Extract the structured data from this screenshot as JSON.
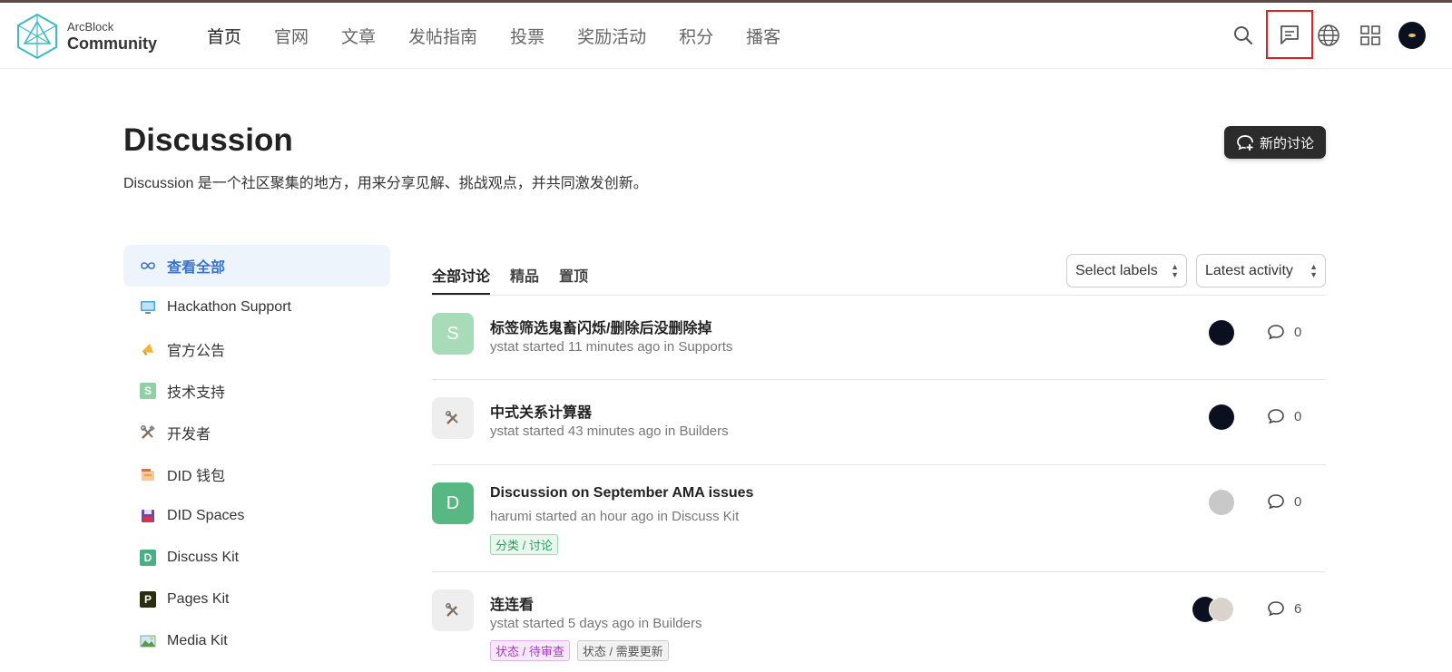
{
  "header": {
    "logo_line1": "ArcBlock",
    "logo_line2": "Community",
    "nav": [
      {
        "label": "首页",
        "active": true
      },
      {
        "label": "官网"
      },
      {
        "label": "文章"
      },
      {
        "label": "发帖指南"
      },
      {
        "label": "投票"
      },
      {
        "label": "奖励活动"
      },
      {
        "label": "积分"
      },
      {
        "label": "播客"
      }
    ],
    "icons": [
      "search-icon",
      "chat-icon",
      "globe-icon",
      "apps-grid-icon",
      "user-avatar"
    ]
  },
  "page": {
    "title": "Discussion",
    "subtitle": "Discussion 是一个社区聚集的地方，用来分享见解、挑战观点，并共同激发创新。",
    "new_button": "新的讨论"
  },
  "sidebar": {
    "items": [
      {
        "label": "查看全部",
        "icon": "infinity-icon",
        "active": true
      },
      {
        "label": "Hackathon Support",
        "icon": "monitor-icon"
      },
      {
        "label": "官方公告",
        "icon": "megaphone-icon"
      },
      {
        "label": "技术支持",
        "icon": "letter-s-icon",
        "icon_text": "S",
        "color": "#8fd1a4"
      },
      {
        "label": "开发者",
        "icon": "tools-icon"
      },
      {
        "label": "DID 钱包",
        "icon": "wallet-icon"
      },
      {
        "label": "DID Spaces",
        "icon": "floppy-icon"
      },
      {
        "label": "Discuss Kit",
        "icon": "letter-d-icon",
        "icon_text": "D",
        "color": "#4caf82"
      },
      {
        "label": "Pages Kit",
        "icon": "letter-p-icon",
        "icon_text": "P",
        "color": "#2c2c10"
      },
      {
        "label": "Media Kit",
        "icon": "image-icon"
      }
    ]
  },
  "tabs": [
    {
      "label": "全部讨论",
      "active": true
    },
    {
      "label": "精品"
    },
    {
      "label": "置顶"
    }
  ],
  "filters": {
    "labels_select": "Select labels",
    "sort_select": "Latest activity"
  },
  "topics": [
    {
      "avatar_text": "S",
      "avatar_color": "#a8dbb7",
      "title": "标签筛选鬼畜闪烁/删除后没删除掉",
      "meta": "ystat started 11 minutes ago in Supports",
      "tags": [],
      "comments": "0"
    },
    {
      "avatar_text": "🛠",
      "avatar_color": "#eeeeee",
      "title": "中式关系计算器",
      "meta": "ystat started 43 minutes ago in Builders",
      "tags": [],
      "comments": "0"
    },
    {
      "avatar_text": "D",
      "avatar_color": "#58b883",
      "title": "Discussion on September AMA issues",
      "meta": "harumi started an hour ago in Discuss Kit",
      "tags": [
        {
          "label": "分类 / 讨论",
          "color": "#2e9a5a",
          "bg": "#eaf7ee"
        }
      ],
      "comments": "0"
    },
    {
      "avatar_text": "🛠",
      "avatar_color": "#eeeeee",
      "title": "连连看",
      "meta": "ystat started 5 days ago in Builders",
      "tags": [
        {
          "label": "状态 / 待审查",
          "color": "#a23bb8",
          "bg": "#f7e9fb"
        },
        {
          "label": "状态 / 需要更新",
          "color": "#555555",
          "bg": "#f2f2f2"
        }
      ],
      "comments": "6"
    }
  ]
}
